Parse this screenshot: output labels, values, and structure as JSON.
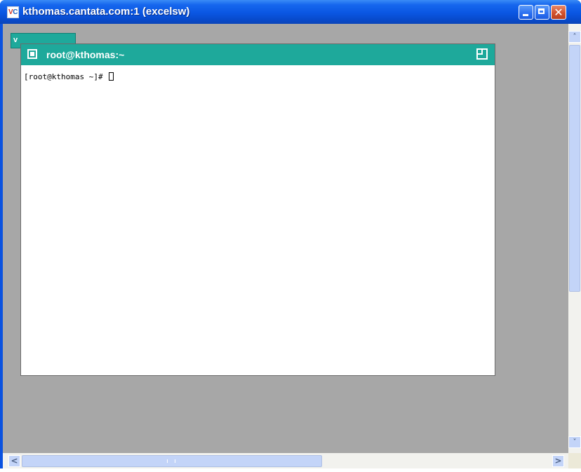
{
  "window": {
    "title": "kthomas.cantata.com:1 (excelsw)",
    "icon_text_v": "V",
    "icon_text_c": "C",
    "close_glyph": "✕"
  },
  "desktop": {
    "background_tab_label": "v"
  },
  "terminal": {
    "title": "root@kthomas:~",
    "prompt": "[root@kthomas ~]# "
  },
  "scrollbars": {
    "up_arrow": "˄",
    "down_arrow": "˅",
    "left_arrow": "<",
    "right_arrow": ">"
  },
  "colors": {
    "xp_title_blue": "#0a56e2",
    "xterm_titlebar": "#1ea99b",
    "desktop_gray": "#a7a7a7",
    "close_red": "#d2522e"
  }
}
